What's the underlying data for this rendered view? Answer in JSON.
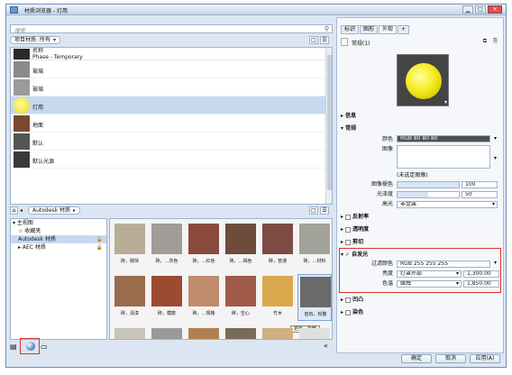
{
  "window": {
    "title": "材质浏览器 - 灯用"
  },
  "search": {
    "placeholder": "搜索"
  },
  "filter": {
    "label": "项目材质: 所有"
  },
  "list": {
    "header": [
      "名称",
      "Phase - Temporary"
    ],
    "rows": [
      {
        "name": "玻璃",
        "color": "#8a8a8a",
        "selected": false
      },
      {
        "name": "玻璃",
        "color": "#9a9a9a",
        "selected": false
      },
      {
        "name": "灯用",
        "color": "#f2e84a",
        "selected": true
      },
      {
        "name": "地面",
        "color": "#7a4a2e",
        "selected": false
      },
      {
        "name": "默认",
        "color": "#555555",
        "selected": false
      },
      {
        "name": "默认光源",
        "color": "#3a3a3a",
        "selected": false
      }
    ]
  },
  "library": {
    "label": "Autodesk 材质"
  },
  "tree": {
    "items": [
      {
        "label": "▾ 主视图",
        "indent": 0
      },
      {
        "label": "☆ 收藏夹",
        "indent": 1
      },
      {
        "label": "Autodesk 材质",
        "indent": 1,
        "selected": true,
        "lock": "🔒"
      },
      {
        "label": "▸ AEC 材质",
        "indent": 1,
        "lock": "🔒"
      }
    ]
  },
  "tiles": [
    {
      "label": "砖，砌块",
      "color": "#b9ad98"
    },
    {
      "label": "砖，…灰色",
      "color": "#a09c98"
    },
    {
      "label": "砖，…红色",
      "color": "#8a4a3e"
    },
    {
      "label": "砖，…褐色",
      "color": "#6e4b3a"
    },
    {
      "label": "砖，普通",
      "color": "#7e4a44"
    },
    {
      "label": "砖，…材料",
      "color": "#a3a29b"
    },
    {
      "label": "砖，清漆",
      "color": "#9a6b4c"
    },
    {
      "label": "砖，模数",
      "color": "#9c4a30"
    },
    {
      "label": "砖，…规格",
      "color": "#c08b6d"
    },
    {
      "label": "砖，空心",
      "color": "#a05a4a"
    },
    {
      "label": "竹木",
      "color": "#d9a94e"
    },
    {
      "label": "岩石，松散",
      "color": "#6a6a6a"
    },
    {
      "label": "",
      "color": "#c8c4b8"
    },
    {
      "label": "",
      "color": "#9a9a9a"
    },
    {
      "label": "",
      "color": "#b08050"
    },
    {
      "label": "",
      "color": "#7a6a5a"
    },
    {
      "label": "",
      "color": "#d0b080"
    },
    {
      "label": "",
      "color": "#e0e0e0"
    }
  ],
  "tooltip": "岩石，松散",
  "right": {
    "tabs": [
      "标识",
      "图形",
      "外观",
      "+"
    ],
    "material_name": "常规(1)",
    "sections": {
      "info": "信息",
      "general": "常规",
      "reflect": "反射率",
      "transparency": "透明度",
      "cutout": "剪切",
      "selfillum": "自发光",
      "bump": "凹凸",
      "tint": "染色"
    },
    "props": {
      "color_label": "颜色",
      "color_value": "RGB 80 80 80",
      "image_label": "图像",
      "image_note": "(未选定图像)",
      "fade_label": "图像褪色",
      "fade_value": "100",
      "gloss_label": "光泽度",
      "gloss_value": "50",
      "highlight_label": "高光",
      "highlight_value": "非金属",
      "filter_label": "过滤颜色",
      "filter_value": "RGB 255 255 255",
      "lum_label": "亮度",
      "lum_mode": "灯罩外部",
      "lum_value": "1,300.00",
      "temp_label": "色温",
      "temp_mode": "蜡烛",
      "temp_value": "1,850.00"
    }
  },
  "buttons": {
    "ok": "确定",
    "cancel": "取消",
    "apply": "应用(A)"
  }
}
